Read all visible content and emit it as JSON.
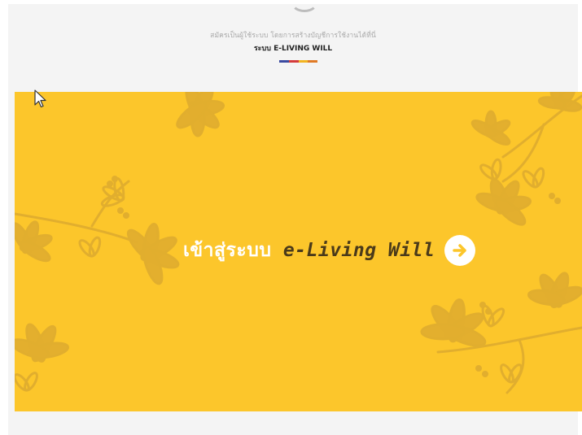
{
  "header": {
    "subtitle": "สมัครเป็นผู้ใช้ระบบ โดยการสร้างบัญชีการใช้งานได้ที่นี่",
    "system_title": "ระบบ E-LIVING WILL"
  },
  "color_bar": [
    "#3b4aa0",
    "#d43b3b",
    "#f2b420",
    "#e07a25"
  ],
  "banner": {
    "background_color": "#fcc62b",
    "cta_thai": "เข้าสู่ระบบ",
    "cta_english": "e-Living Will",
    "cta_icon": "arrow-right-circle-icon",
    "accent_color": "#fcc62b"
  }
}
